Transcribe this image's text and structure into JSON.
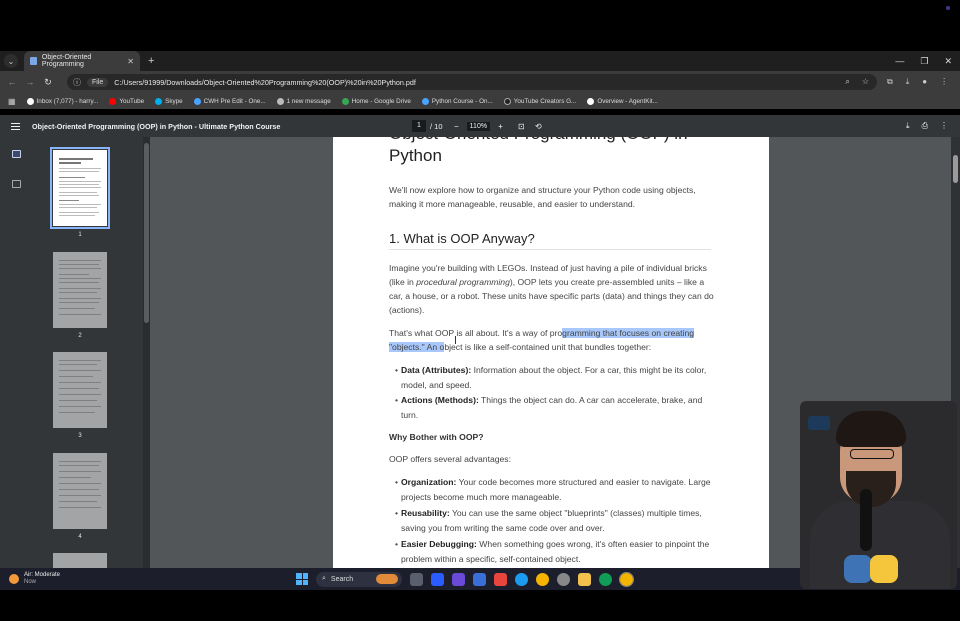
{
  "browser": {
    "tab_title": "Object-Oriented Programming",
    "new_tab_label": "+",
    "file_chip": "File",
    "url": "C:/Users/91999/Downloads/Object-Oriented%20Programming%20(OOP)%20in%20Python.pdf",
    "bookmarks": [
      {
        "label": "Inbox (7,077) - harry...",
        "color": "#ffffff"
      },
      {
        "label": "YouTube",
        "color": "#ff0000"
      },
      {
        "label": "Skype",
        "color": "#00aff0"
      },
      {
        "label": "CWH Pre Edit - One...",
        "color": "#4aa3ff"
      },
      {
        "label": "1 new message",
        "color": "#bbbbbb"
      },
      {
        "label": "Home - Google Drive",
        "color": "#34a853"
      },
      {
        "label": "Python Course - On...",
        "color": "#4aa3ff"
      },
      {
        "label": "YouTube Creators G...",
        "color": "#222222"
      },
      {
        "label": "Overview - AgentKit...",
        "color": "#ffffff"
      }
    ]
  },
  "pdf_toolbar": {
    "title": "Object-Oriented Programming (OOP) in Python - Ultimate Python Course",
    "current_page": "1",
    "total_pages": "/ 10",
    "zoom": "110%",
    "zoom_out": "−",
    "zoom_in": "+"
  },
  "thumbnails": [
    "1",
    "2",
    "3",
    "4"
  ],
  "document": {
    "heading": "Object-Oriented Programming (OOP) in Python",
    "intro": "We'll now explore how to organize and structure your Python code using objects, making it more manageable, reusable, and easier to understand.",
    "section_title": "1. What is OOP Anyway?",
    "para1_a": "Imagine you're building with LEGOs. Instead of just having a pile of individual bricks (like in ",
    "para1_em": "procedural programming",
    "para1_b": "), OOP lets you create pre-assembled units – like a car, a house, or a robot. These units have specific parts (data) and things they can do (actions).",
    "para2_a": "That's what OOP is all about. It's a way of pro",
    "para2_hl": "gramming that focuses on creating \"objects.\" An o",
    "para2_b": "bject is like a self-contained unit that bundles together:",
    "bullets1": [
      {
        "term": "Data (Attributes):",
        "text": " Information about the object. For a car, this might be its color, model, and speed."
      },
      {
        "term": "Actions (Methods):",
        "text": " Things the object can do. A car can accelerate, brake, and turn."
      }
    ],
    "why_title": "Why Bother with OOP?",
    "why_intro": "OOP offers several advantages:",
    "bullets2": [
      {
        "term": "Organization:",
        "text": " Your code becomes more structured and easier to navigate. Large projects become much more manageable."
      },
      {
        "term": "Reusability:",
        "text": " You can use the same object \"blueprints\" (classes) multiple times, saving you from writing the same code over and over."
      },
      {
        "term": "Easier Debugging:",
        "text": " When something goes wrong, it's often easier to pinpoint the problem within a specific, self-contained object."
      }
    ]
  },
  "taskbar": {
    "weather_title": "Air: Moderate",
    "weather_sub": "Now",
    "search_label": "Search",
    "apps": [
      "#5a5f6e",
      "#2b5cff",
      "#6a4bd8",
      "#3a6fd8",
      "#e8453c",
      "#1d9bf0",
      "#f4b400",
      "#888888",
      "#f2c14e",
      "#0f9d58",
      "#f4b400"
    ]
  }
}
